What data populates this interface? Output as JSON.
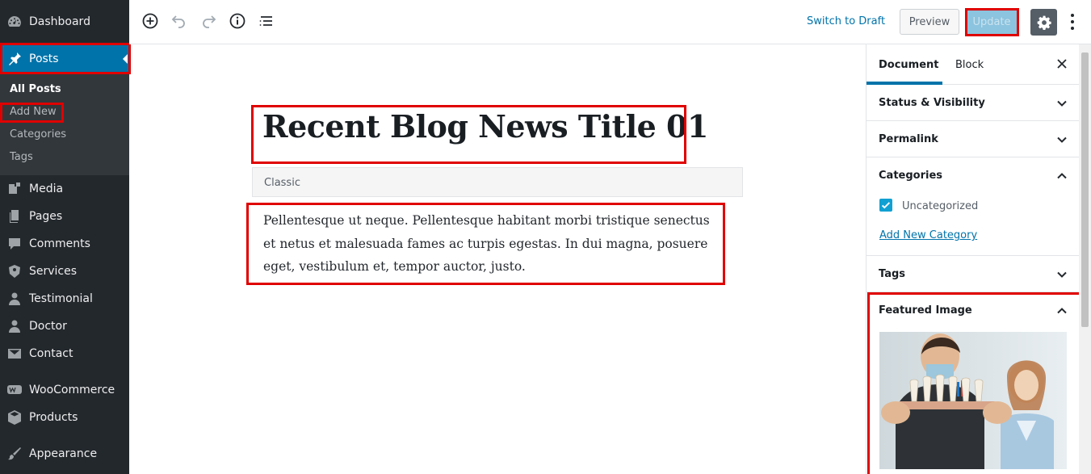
{
  "sidebar": {
    "items": [
      {
        "label": "Dashboard",
        "icon": "dashboard-icon"
      },
      {
        "label": "Posts",
        "icon": "pin-icon"
      },
      {
        "label": "Media",
        "icon": "media-icon"
      },
      {
        "label": "Pages",
        "icon": "pages-icon"
      },
      {
        "label": "Comments",
        "icon": "comments-icon"
      },
      {
        "label": "Services",
        "icon": "services-icon"
      },
      {
        "label": "Testimonial",
        "icon": "user-icon"
      },
      {
        "label": "Doctor",
        "icon": "user-icon"
      },
      {
        "label": "Contact",
        "icon": "email-icon"
      },
      {
        "label": "WooCommerce",
        "icon": "woo-icon"
      },
      {
        "label": "Products",
        "icon": "products-icon"
      },
      {
        "label": "Appearance",
        "icon": "brush-icon"
      }
    ],
    "submenu": [
      "All Posts",
      "Add New",
      "Categories",
      "Tags"
    ]
  },
  "toolbar": {
    "switch_draft": "Switch to Draft",
    "preview": "Preview",
    "update": "Update"
  },
  "editor": {
    "title": "Recent Blog News Title 01",
    "classic_label": "Classic",
    "content": "Pellentesque ut neque. Pellentesque habitant morbi tristique senectus et netus et malesuada fames ac turpis egestas. In dui magna, posuere eget, vestibulum et, tempor auctor, justo."
  },
  "panel": {
    "tabs": [
      "Document",
      "Block"
    ],
    "sections": {
      "status": "Status & Visibility",
      "permalink": "Permalink",
      "categories": "Categories",
      "tags": "Tags",
      "featured": "Featured Image"
    },
    "category_item": "Uncategorized",
    "add_category": "Add New Category"
  },
  "colors": {
    "admin_bg": "#23282d",
    "accent": "#0073aa",
    "highlight_box": "#e00000"
  }
}
